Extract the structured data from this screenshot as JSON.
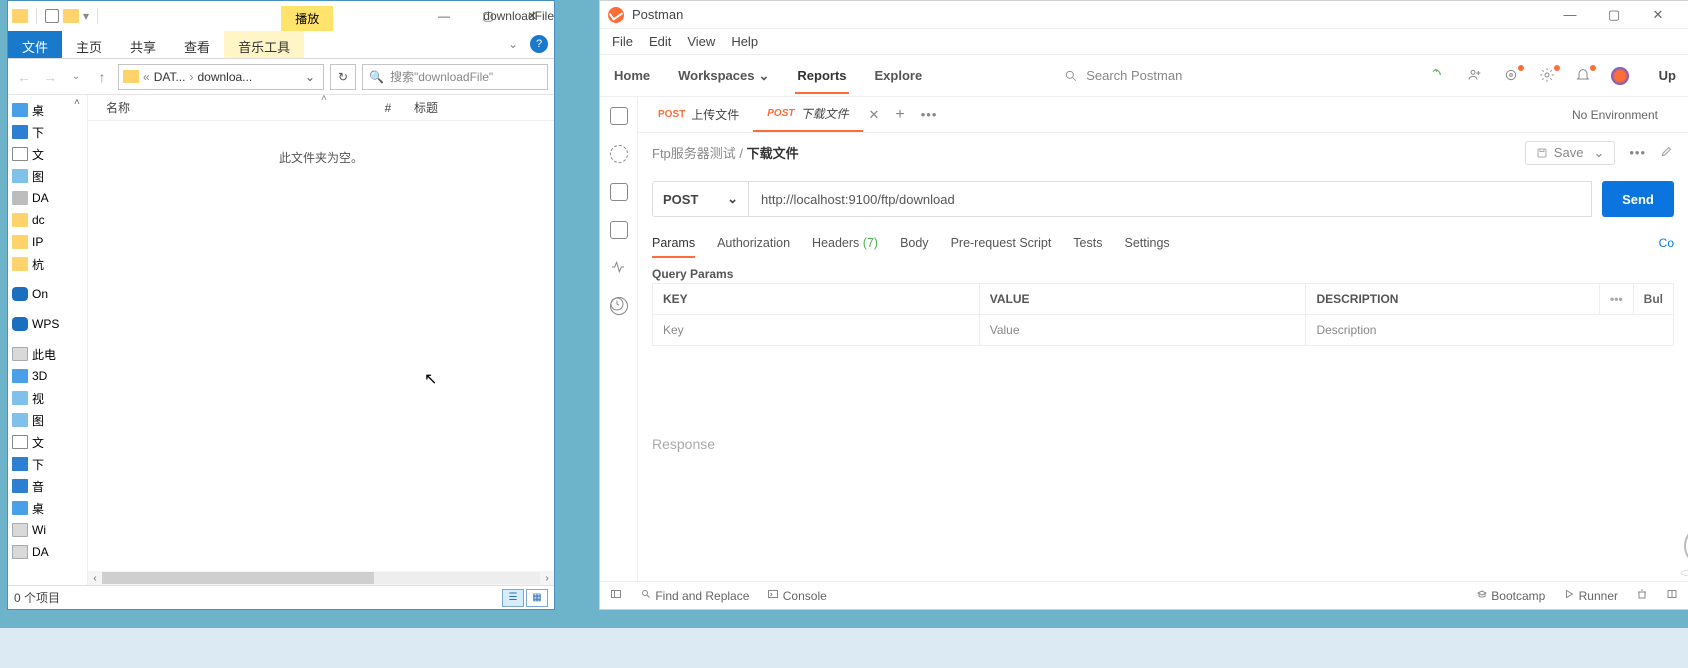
{
  "explorer": {
    "title": "downloadFile",
    "play_tab": "播放",
    "ribbon": {
      "file": "文件",
      "home": "主页",
      "share": "共享",
      "view": "查看",
      "music_tools": "音乐工具"
    },
    "nav": {
      "back": "←",
      "fwd": "→",
      "up": "↑",
      "crumb_sep": "«",
      "crumb1": "DAT...",
      "crumb2": "downloa...",
      "refresh": "↻",
      "search_placeholder": "搜索\"downloadFile\""
    },
    "tree": [
      {
        "icon": "blue",
        "label": "桌"
      },
      {
        "icon": "darrow",
        "label": "下"
      },
      {
        "icon": "doc",
        "label": "文"
      },
      {
        "icon": "pic",
        "label": "图"
      },
      {
        "icon": "disk",
        "label": "DA"
      },
      {
        "icon": "folder",
        "label": "dc"
      },
      {
        "icon": "folder",
        "label": "IP"
      },
      {
        "icon": "folder",
        "label": "杭"
      },
      {
        "icon": "cloud",
        "label": "On"
      },
      {
        "icon": "cloud",
        "label": "WPS"
      },
      {
        "icon": "drive",
        "label": "此电"
      },
      {
        "icon": "blue",
        "label": "3D"
      },
      {
        "icon": "pic",
        "label": "视"
      },
      {
        "icon": "pic",
        "label": "图"
      },
      {
        "icon": "doc",
        "label": "文"
      },
      {
        "icon": "darrow",
        "label": "下"
      },
      {
        "icon": "music",
        "label": "音"
      },
      {
        "icon": "blue",
        "label": "桌"
      },
      {
        "icon": "drive",
        "label": "Wi"
      },
      {
        "icon": "drive",
        "label": "DA"
      }
    ],
    "columns": {
      "name": "名称",
      "num": "#",
      "title_col": "标题"
    },
    "empty_msg": "此文件夹为空。",
    "status": "0 个项目"
  },
  "postman": {
    "app_title": "Postman",
    "menu": {
      "file": "File",
      "edit": "Edit",
      "view": "View",
      "help": "Help"
    },
    "header": {
      "home": "Home",
      "workspaces": "Workspaces",
      "reports": "Reports",
      "explore": "Explore",
      "search_placeholder": "Search Postman",
      "upgrade": "Up"
    },
    "tabs": {
      "t1_method": "POST",
      "t1_name": "上传文件",
      "t2_method": "POST",
      "t2_name": "下载文件",
      "no_env": "No Environment"
    },
    "breadcrumb": {
      "parent": "Ftp服务器测试",
      "sep": "/",
      "current": "下载文件",
      "save": "Save"
    },
    "request": {
      "method": "POST",
      "url": "http://localhost:9100/ftp/download",
      "send": "Send"
    },
    "subtabs": {
      "params": "Params",
      "auth": "Authorization",
      "headers": "Headers",
      "headers_count": "(7)",
      "body": "Body",
      "prereq": "Pre-request Script",
      "tests": "Tests",
      "settings": "Settings",
      "cookies": "Co"
    },
    "qp_label": "Query Params",
    "kv": {
      "key_h": "KEY",
      "val_h": "VALUE",
      "desc_h": "DESCRIPTION",
      "bulk": "Bul",
      "key_ph": "Key",
      "val_ph": "Value",
      "desc_ph": "Description"
    },
    "response_label": "Response",
    "footer": {
      "find": "Find and Replace",
      "console": "Console",
      "bootcamp": "Bootcamp",
      "runner": "Runner"
    }
  }
}
